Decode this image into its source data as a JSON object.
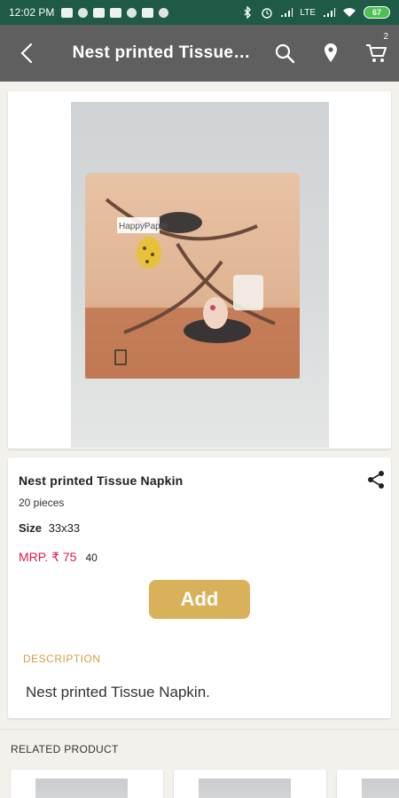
{
  "status_bar": {
    "time": "12:02 PM",
    "network": "LTE",
    "battery": "67"
  },
  "app_bar": {
    "title": "Nest printed Tissue Napkin",
    "cart_count": "2"
  },
  "product": {
    "brand_on_package": "HappyPaper",
    "name": "Nest printed Tissue Napkin",
    "pieces": "20 pieces",
    "size_label": "Size",
    "size_value": "33x33",
    "mrp": "MRP. ₹ 75",
    "price": "40",
    "add_label": "Add",
    "description_heading": "DESCRIPTION",
    "description": "Nest printed Tissue Napkin."
  },
  "related": {
    "heading": "RELATED PRODUCT"
  },
  "colors": {
    "status_bar": "#1f5a47",
    "app_bar": "#5f5f5f",
    "accent": "#d9b15a",
    "mrp": "#e0194f"
  },
  "icons": [
    "back-icon",
    "search-icon",
    "location-pin-icon",
    "cart-icon",
    "share-icon"
  ]
}
